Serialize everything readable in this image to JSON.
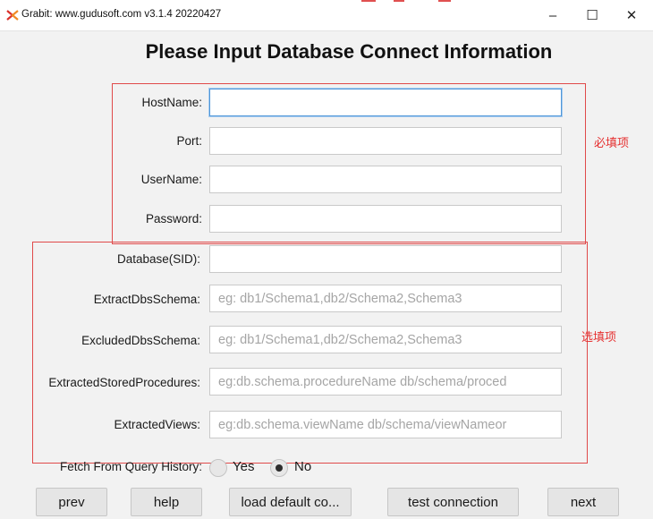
{
  "window": {
    "title": "Grabit: www.gudusoft.com  v3.1.4 20220427",
    "icon": "grabit-logo-icon",
    "minimize_glyph": "–",
    "maximize_glyph": "☐",
    "close_glyph": "✕"
  },
  "heading": "Please Input Database Connect Information",
  "annotations": {
    "required": "必填项",
    "optional": "选填项",
    "color": "#e04a4a"
  },
  "fields": {
    "hostname": {
      "label": "HostName:",
      "value": "",
      "placeholder": ""
    },
    "port": {
      "label": "Port:",
      "value": "",
      "placeholder": ""
    },
    "username": {
      "label": "UserName:",
      "value": "",
      "placeholder": ""
    },
    "password": {
      "label": "Password:",
      "value": "",
      "placeholder": ""
    },
    "database": {
      "label": "Database(SID):",
      "value": "",
      "placeholder": ""
    },
    "extract_schema": {
      "label": "ExtractDbsSchema:",
      "value": "",
      "placeholder": "eg: db1/Schema1,db2/Schema2,Schema3"
    },
    "excluded_schema": {
      "label": "ExcludedDbsSchema:",
      "value": "",
      "placeholder": "eg: db1/Schema1,db2/Schema2,Schema3"
    },
    "stored_procedures": {
      "label": "ExtractedStoredProcedures:",
      "value": "",
      "placeholder": "eg:db.schema.procedureName db/schema/proced"
    },
    "views": {
      "label": "ExtractedViews:",
      "value": "",
      "placeholder": "eg:db.schema.viewName db/schema/viewNameor"
    }
  },
  "query_history": {
    "label": "Fetch From Query History:",
    "yes": "Yes",
    "no": "No",
    "selected": "No"
  },
  "buttons": {
    "prev": "prev",
    "help": "help",
    "load_default": "load default co...",
    "test_connection": "test connection",
    "next": "next"
  },
  "colors": {
    "focus": "#4f96d8",
    "background": "#f2f2f2"
  }
}
